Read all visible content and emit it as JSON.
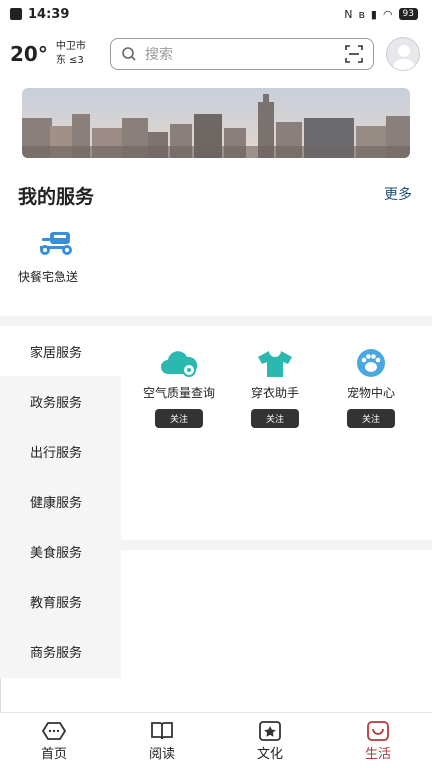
{
  "status_bar": {
    "time": "14:39",
    "battery": "93"
  },
  "weather": {
    "temperature": "20°",
    "city": "中卫市",
    "wind": "东 ≤3"
  },
  "search": {
    "placeholder": "搜索"
  },
  "services": {
    "title": "我的服务",
    "more": "更多",
    "quick": [
      {
        "label": "快餐宅急送",
        "icon": "scooter-icon"
      }
    ]
  },
  "categories": [
    "家居服务",
    "政务服务",
    "出行服务",
    "健康服务",
    "美食服务",
    "教育服务",
    "商务服务"
  ],
  "active_category": 0,
  "service_cards": [
    {
      "name": "空气质量查询",
      "action": "关注",
      "icon": "cloud-icon"
    },
    {
      "name": "穿衣助手",
      "action": "关注",
      "icon": "tshirt-icon"
    },
    {
      "name": "宠物中心",
      "action": "关注",
      "icon": "paw-icon"
    }
  ],
  "tabs": [
    {
      "label": "首页",
      "icon": "home-icon"
    },
    {
      "label": "阅读",
      "icon": "book-icon"
    },
    {
      "label": "文化",
      "icon": "star-icon"
    },
    {
      "label": "生活",
      "icon": "smile-bag-icon"
    }
  ],
  "colors": {
    "accent": "#b4393a",
    "teal": "#2bb8b0",
    "link": "#1e4f7a"
  }
}
